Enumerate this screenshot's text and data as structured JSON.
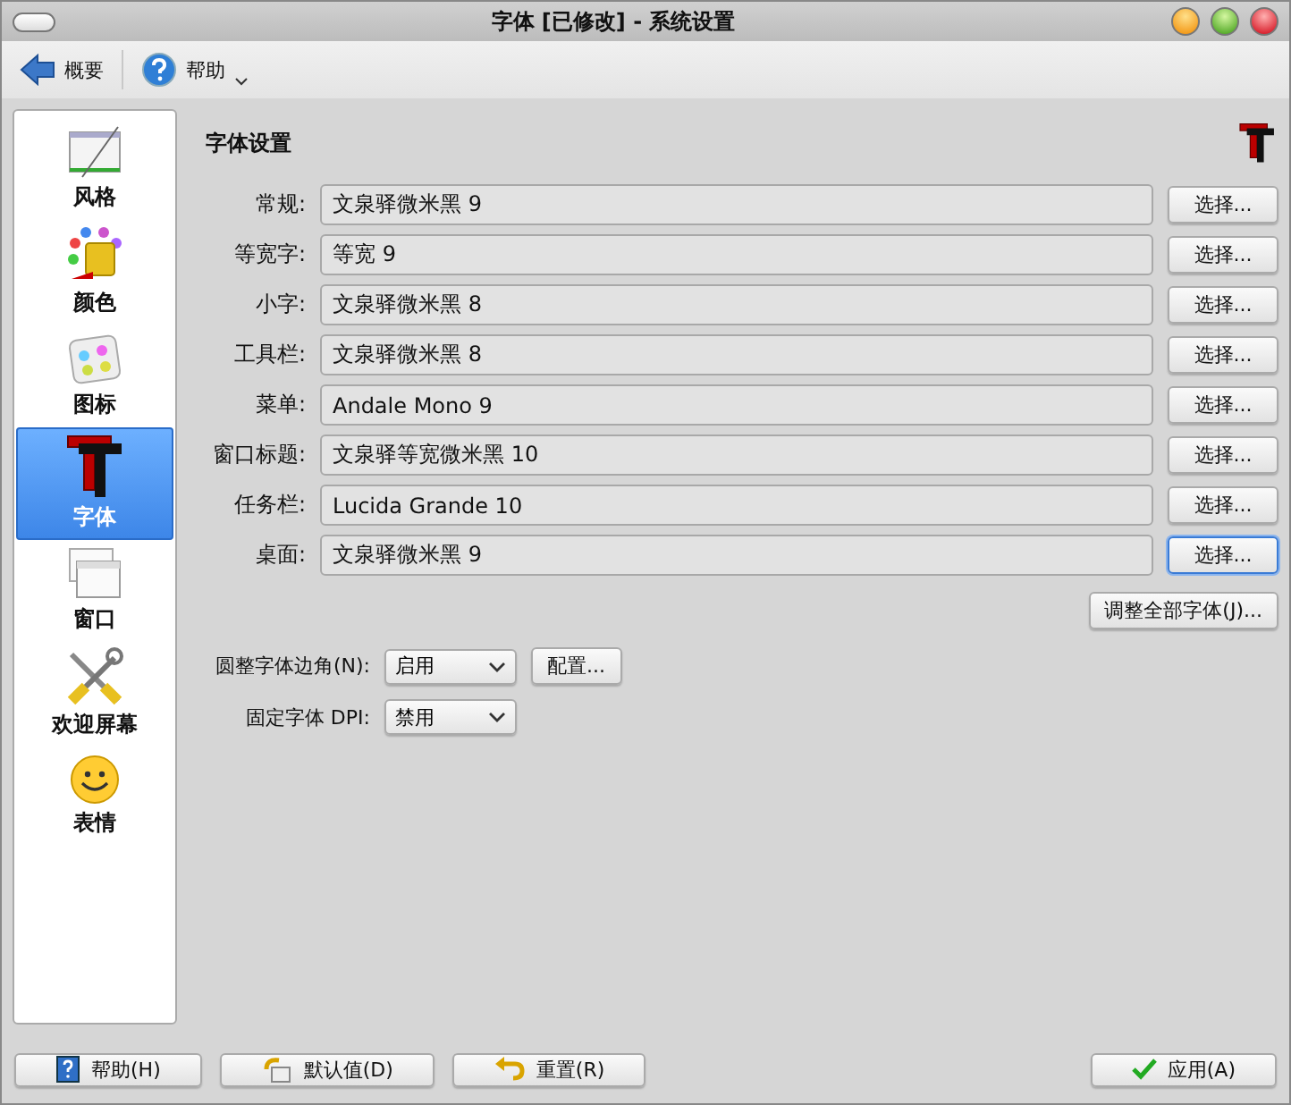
{
  "window": {
    "title": "字体 [已修改] - 系统设置"
  },
  "toolbar": [
    {
      "kind": "back",
      "label": "概要"
    },
    {
      "kind": "help",
      "label": "帮助"
    }
  ],
  "sidebar": {
    "items": [
      {
        "kind": "style",
        "label": "风格",
        "selected": false
      },
      {
        "kind": "color",
        "label": "颜色",
        "selected": false
      },
      {
        "kind": "icons",
        "label": "图标",
        "selected": false
      },
      {
        "kind": "font",
        "label": "字体",
        "selected": true
      },
      {
        "kind": "window",
        "label": "窗口",
        "selected": false
      },
      {
        "kind": "tools",
        "label": "欢迎屏幕",
        "selected": false
      },
      {
        "kind": "smiley",
        "label": "表情",
        "selected": false
      }
    ]
  },
  "section_title": "字体设置",
  "fonts": [
    {
      "label": "常规:",
      "value": "文泉驿微米黑 9",
      "button": "选择...",
      "focused": false
    },
    {
      "label": "等宽字:",
      "value": "等宽  9",
      "button": "选择...",
      "focused": false
    },
    {
      "label": "小字:",
      "value": "文泉驿微米黑 8",
      "button": "选择...",
      "focused": false
    },
    {
      "label": "工具栏:",
      "value": "文泉驿微米黑 8",
      "button": "选择...",
      "focused": false
    },
    {
      "label": "菜单:",
      "value": "Andale Mono 9",
      "button": "选择...",
      "focused": false
    },
    {
      "label": "窗口标题:",
      "value": "文泉驿等宽微米黑  10",
      "button": "选择...",
      "focused": false
    },
    {
      "label": "任务栏:",
      "value": "Lucida Grande 10",
      "button": "选择...",
      "focused": false
    },
    {
      "label": "桌面:",
      "value": "文泉驿微米黑 9",
      "button": "选择...",
      "focused": true
    }
  ],
  "adjust_all_button": "调整全部字体(J)...",
  "options": [
    {
      "label": "圆整字体边角(N):",
      "value": "启用",
      "button": "配置..."
    },
    {
      "label": "固定字体 DPI:",
      "value": "禁用"
    }
  ],
  "bottom_buttons": [
    {
      "kind": "help",
      "label": "帮助(H)"
    },
    {
      "kind": "defaults",
      "label": "默认值(D)"
    },
    {
      "kind": "reset",
      "label": "重置(R)"
    },
    {
      "kind": "apply",
      "label": "应用(A)"
    }
  ]
}
